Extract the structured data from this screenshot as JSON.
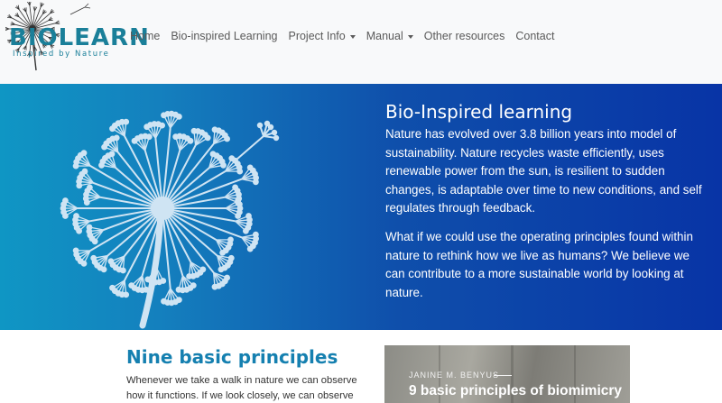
{
  "logo": {
    "brand": "BIOLEARN",
    "tagline": "Inspired by Nature"
  },
  "nav": {
    "items": [
      {
        "label": "Home"
      },
      {
        "label": "Bio-inspired Learning"
      },
      {
        "label": "Project Info",
        "dropdown": true
      },
      {
        "label": "Manual",
        "dropdown": true
      },
      {
        "label": "Other resources"
      },
      {
        "label": "Contact"
      }
    ]
  },
  "hero": {
    "title": "Bio-Inspired learning",
    "p1": "Nature has evolved over 3.8 billion years into model of sustainability. Nature recycles waste efficiently, uses renewable power from the sun, is resilient to sudden changes, is adaptable over time to new conditions, and self regulates through feedback.",
    "p2": "What if we could use the operating principles found within nature to rethink how we live as humans? We believe we can contribute to a more sustainable world by looking at nature."
  },
  "principles": {
    "title": "Nine basic principles",
    "text": "Whenever we take a walk in nature we can observe how it functions. If we look closely, we can observe"
  },
  "book": {
    "author": "JANINE M. BENYUS",
    "title": "9 basic principles of biomimicry"
  },
  "colors": {
    "brand": "#1a7f99",
    "hero_start": "#0f96c4",
    "hero_end": "#0834a6",
    "section_title": "#1580b0",
    "dandelion": "#cfe4f3"
  }
}
